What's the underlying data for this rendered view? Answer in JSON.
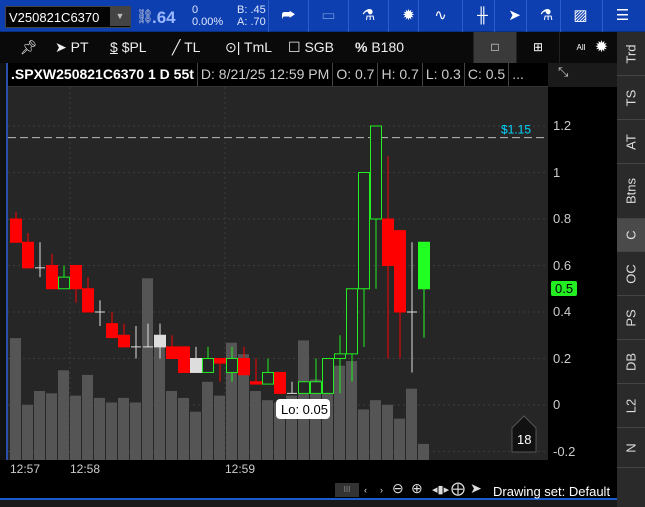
{
  "topbar": {
    "symbol": "V250821C6370",
    "last": ".64",
    "change": "0",
    "change_pct": "0.00%",
    "bid": "B: .45",
    "ask": "A: .70",
    "icons": [
      "share-icon",
      "screen-icon",
      "flask-icon",
      "gear-icon",
      "pulse-icon",
      "candle-icon",
      "cursor-icon",
      "flask-icon",
      "chart-icon",
      "menu-icon"
    ]
  },
  "toolbar2": {
    "pin": "pin-icon",
    "pt": "PT",
    "spl": "$PL",
    "tl": "TL",
    "tml": "TmL",
    "sgb": "SGB",
    "b180": "B180",
    "all": "All"
  },
  "header": {
    "title": ".SPXW250821C6370 1 D 55t",
    "date": "D: 8/21/25 12:59 PM",
    "open": "O: 0.7",
    "high": "H: 0.7",
    "low": "L: 0.3",
    "close": "C: 0.5",
    "more": "..."
  },
  "tabs": [
    "Trd",
    "TS",
    "AT",
    "Btns",
    "C",
    "OC",
    "PS",
    "DB",
    "L2",
    "N"
  ],
  "active_tab": "C",
  "chart_data": {
    "type": "candlestick",
    "yticks": [
      1.2,
      1,
      0.8,
      0.6,
      0.4,
      0.2,
      0,
      -0.2
    ],
    "ytick_labels": [
      "1.2",
      "1",
      "0.8",
      "0.6",
      "0.4",
      "0.2",
      "0",
      "-0.2"
    ],
    "ylim": [
      -0.2,
      1.37
    ],
    "xtick_labels": [
      "12:57",
      "12:58",
      "12:59"
    ],
    "price_line": {
      "value": 1.15,
      "label": "$1.15",
      "color": "#00d8ff"
    },
    "last_price": {
      "value": 0.5,
      "label": "0.5",
      "color": "#22ee22"
    },
    "low_label": "Lo: 0.05",
    "volume_badge": "18",
    "candles": [
      [
        0.8,
        0.83,
        0.7,
        0.7
      ],
      [
        0.7,
        0.74,
        0.59,
        0.59
      ],
      [
        0.59,
        0.7,
        0.55,
        0.59
      ],
      [
        0.6,
        0.65,
        0.5,
        0.5
      ],
      [
        0.5,
        0.6,
        0.5,
        0.55
      ],
      [
        0.6,
        0.6,
        0.44,
        0.5
      ],
      [
        0.5,
        0.55,
        0.4,
        0.4
      ],
      [
        0.4,
        0.45,
        0.34,
        0.4
      ],
      [
        0.35,
        0.4,
        0.29,
        0.29
      ],
      [
        0.3,
        0.35,
        0.25,
        0.25
      ],
      [
        0.25,
        0.34,
        0.2,
        0.25
      ],
      [
        0.25,
        0.35,
        0.25,
        0.25
      ],
      [
        0.3,
        0.35,
        0.2,
        0.25
      ],
      [
        0.25,
        0.3,
        0.2,
        0.2
      ],
      [
        0.25,
        0.25,
        0.14,
        0.14
      ],
      [
        0.2,
        0.25,
        0.14,
        0.14
      ],
      [
        0.14,
        0.25,
        0.14,
        0.2
      ],
      [
        0.2,
        0.2,
        0.1,
        0.18
      ],
      [
        0.14,
        0.25,
        0.1,
        0.2
      ],
      [
        0.2,
        0.25,
        0.13,
        0.13
      ],
      [
        0.1,
        0.2,
        0.09,
        0.09
      ],
      [
        0.09,
        0.2,
        0.09,
        0.14
      ],
      [
        0.14,
        0.14,
        0.05,
        0.05
      ],
      [
        0.05,
        0.1,
        0.05,
        0.05
      ],
      [
        0.05,
        0.1,
        0.05,
        0.1
      ],
      [
        0.05,
        0.2,
        0.05,
        0.1
      ],
      [
        0.05,
        0.2,
        0.05,
        0.2
      ],
      [
        0.2,
        0.3,
        0.05,
        0.22
      ],
      [
        0.22,
        0.5,
        0.1,
        0.5
      ],
      [
        0.5,
        1.0,
        0.25,
        1.0
      ],
      [
        0.8,
        1.2,
        0.5,
        1.2
      ],
      [
        0.8,
        1.07,
        0.2,
        0.6
      ],
      [
        0.75,
        0.75,
        0.2,
        0.4
      ],
      [
        0.4,
        0.7,
        0.14,
        0.4
      ],
      [
        0.5,
        0.7,
        0.29,
        0.7
      ]
    ],
    "volume": [
      53,
      24,
      30,
      29,
      39,
      28,
      37,
      27,
      25,
      27,
      25,
      79,
      50,
      30,
      27,
      21,
      34,
      28,
      51,
      46,
      30,
      26,
      25,
      28,
      52,
      35,
      35,
      41,
      43,
      22,
      26,
      24,
      18,
      31,
      7
    ]
  },
  "bottom": {
    "drawing_set": "Drawing set: Default"
  }
}
